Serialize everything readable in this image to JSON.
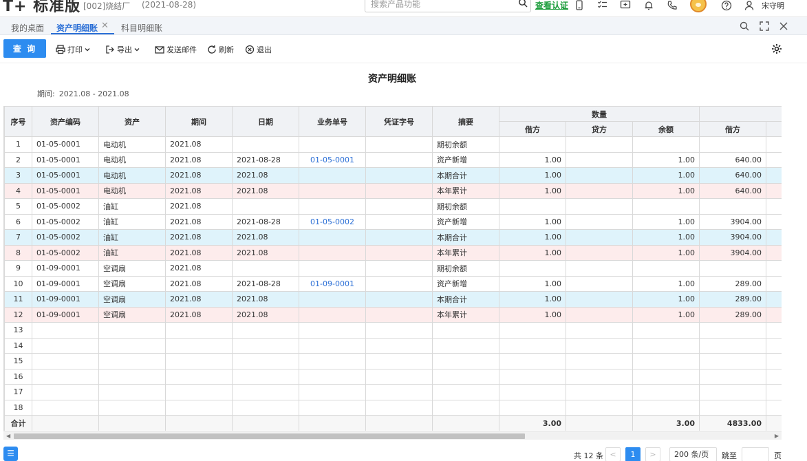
{
  "header": {
    "brand": "标准版",
    "brand_prefix": "T+",
    "company": "[002]烧结厂",
    "date": "(2021-08-28)",
    "search_placeholder": "搜索产品功能",
    "verify_link": "查看认证",
    "user_name": "宋守明"
  },
  "tabs": [
    {
      "label": "我的桌面",
      "active": false
    },
    {
      "label": "资产明细账",
      "active": true
    },
    {
      "label": "科目明细账",
      "active": false
    }
  ],
  "toolbar": {
    "query": "查 询",
    "print": "打印",
    "export": "导出",
    "send_mail": "发送邮件",
    "refresh": "刷新",
    "exit": "退出"
  },
  "report": {
    "title": "资产明细账",
    "period_label": "期间:",
    "period_value": "2021.08 - 2021.08"
  },
  "grid": {
    "columns": [
      "序号",
      "资产编码",
      "资产",
      "期间",
      "日期",
      "业务单号",
      "凭证字号",
      "摘要"
    ],
    "group_quantity": "数量",
    "sub_columns": [
      "借方",
      "贷方",
      "余额",
      "借方"
    ],
    "rows": [
      {
        "no": "1",
        "code": "01-05-0001",
        "asset": "电动机",
        "period": "2021.08",
        "date": "",
        "doc": "",
        "voucher": "",
        "summary": "期初余额",
        "qd": "",
        "qc": "",
        "qb": "",
        "ad": "",
        "type": "normal"
      },
      {
        "no": "2",
        "code": "01-05-0001",
        "asset": "电动机",
        "period": "2021.08",
        "date": "2021-08-28",
        "doc": "01-05-0001",
        "voucher": "",
        "summary": "资产新增",
        "qd": "1.00",
        "qc": "",
        "qb": "1.00",
        "ad": "640.00",
        "type": "normal"
      },
      {
        "no": "3",
        "code": "01-05-0001",
        "asset": "电动机",
        "period": "2021.08",
        "date": "2021.08",
        "doc": "",
        "voucher": "",
        "summary": "本期合计",
        "qd": "1.00",
        "qc": "",
        "qb": "1.00",
        "ad": "640.00",
        "type": "cur"
      },
      {
        "no": "4",
        "code": "01-05-0001",
        "asset": "电动机",
        "period": "2021.08",
        "date": "2021.08",
        "doc": "",
        "voucher": "",
        "summary": "本年累计",
        "qd": "1.00",
        "qc": "",
        "qb": "1.00",
        "ad": "640.00",
        "type": "ytd"
      },
      {
        "no": "5",
        "code": "01-05-0002",
        "asset": "油缸",
        "period": "2021.08",
        "date": "",
        "doc": "",
        "voucher": "",
        "summary": "期初余额",
        "qd": "",
        "qc": "",
        "qb": "",
        "ad": "",
        "type": "normal"
      },
      {
        "no": "6",
        "code": "01-05-0002",
        "asset": "油缸",
        "period": "2021.08",
        "date": "2021-08-28",
        "doc": "01-05-0002",
        "voucher": "",
        "summary": "资产新增",
        "qd": "1.00",
        "qc": "",
        "qb": "1.00",
        "ad": "3904.00",
        "type": "normal"
      },
      {
        "no": "7",
        "code": "01-05-0002",
        "asset": "油缸",
        "period": "2021.08",
        "date": "2021.08",
        "doc": "",
        "voucher": "",
        "summary": "本期合计",
        "qd": "1.00",
        "qc": "",
        "qb": "1.00",
        "ad": "3904.00",
        "type": "cur"
      },
      {
        "no": "8",
        "code": "01-05-0002",
        "asset": "油缸",
        "period": "2021.08",
        "date": "2021.08",
        "doc": "",
        "voucher": "",
        "summary": "本年累计",
        "qd": "1.00",
        "qc": "",
        "qb": "1.00",
        "ad": "3904.00",
        "type": "ytd"
      },
      {
        "no": "9",
        "code": "01-09-0001",
        "asset": "空调扇",
        "period": "2021.08",
        "date": "",
        "doc": "",
        "voucher": "",
        "summary": "期初余额",
        "qd": "",
        "qc": "",
        "qb": "",
        "ad": "",
        "type": "normal"
      },
      {
        "no": "10",
        "code": "01-09-0001",
        "asset": "空调扇",
        "period": "2021.08",
        "date": "2021-08-28",
        "doc": "01-09-0001",
        "voucher": "",
        "summary": "资产新增",
        "qd": "1.00",
        "qc": "",
        "qb": "1.00",
        "ad": "289.00",
        "type": "normal"
      },
      {
        "no": "11",
        "code": "01-09-0001",
        "asset": "空调扇",
        "period": "2021.08",
        "date": "2021.08",
        "doc": "",
        "voucher": "",
        "summary": "本期合计",
        "qd": "1.00",
        "qc": "",
        "qb": "1.00",
        "ad": "289.00",
        "type": "cur"
      },
      {
        "no": "12",
        "code": "01-09-0001",
        "asset": "空调扇",
        "period": "2021.08",
        "date": "2021.08",
        "doc": "",
        "voucher": "",
        "summary": "本年累计",
        "qd": "1.00",
        "qc": "",
        "qb": "1.00",
        "ad": "289.00",
        "type": "ytd"
      },
      {
        "no": "13",
        "code": "",
        "asset": "",
        "period": "",
        "date": "",
        "doc": "",
        "voucher": "",
        "summary": "",
        "qd": "",
        "qc": "",
        "qb": "",
        "ad": "",
        "type": "normal"
      },
      {
        "no": "14",
        "code": "",
        "asset": "",
        "period": "",
        "date": "",
        "doc": "",
        "voucher": "",
        "summary": "",
        "qd": "",
        "qc": "",
        "qb": "",
        "ad": "",
        "type": "normal"
      },
      {
        "no": "15",
        "code": "",
        "asset": "",
        "period": "",
        "date": "",
        "doc": "",
        "voucher": "",
        "summary": "",
        "qd": "",
        "qc": "",
        "qb": "",
        "ad": "",
        "type": "normal"
      },
      {
        "no": "16",
        "code": "",
        "asset": "",
        "period": "",
        "date": "",
        "doc": "",
        "voucher": "",
        "summary": "",
        "qd": "",
        "qc": "",
        "qb": "",
        "ad": "",
        "type": "normal"
      },
      {
        "no": "17",
        "code": "",
        "asset": "",
        "period": "",
        "date": "",
        "doc": "",
        "voucher": "",
        "summary": "",
        "qd": "",
        "qc": "",
        "qb": "",
        "ad": "",
        "type": "normal"
      },
      {
        "no": "18",
        "code": "",
        "asset": "",
        "period": "",
        "date": "",
        "doc": "",
        "voucher": "",
        "summary": "",
        "qd": "",
        "qc": "",
        "qb": "",
        "ad": "",
        "type": "normal"
      }
    ],
    "total": {
      "label": "合计",
      "qd": "3.00",
      "qb": "3.00",
      "ad": "4833.00"
    }
  },
  "pager": {
    "total": "共 12 条",
    "prev": "<",
    "current": "1",
    "next": ">",
    "page_size": "200 条/页",
    "jump_label": "跳至",
    "page_label": "页"
  },
  "colors": {
    "primary": "#2d8cf0",
    "link": "#2b6fd6",
    "verify": "#1a9c3a",
    "row_current": "#dff3fb",
    "row_ytd": "#fdecec"
  }
}
